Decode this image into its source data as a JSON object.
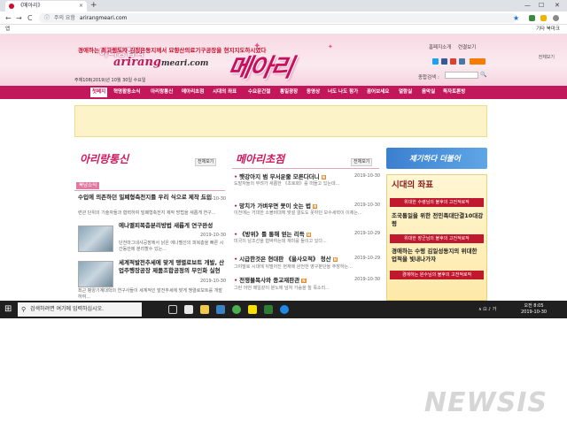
{
  "browser": {
    "tab_title": "《메아리》",
    "tab_close": "×",
    "new_tab": "+",
    "window_min": "—",
    "window_max": "☐",
    "window_close": "✕",
    "nav_back": "←",
    "nav_forward": "→",
    "nav_reload": "C",
    "security_label": "주의 요함",
    "url": "arirangmeari.com",
    "bookmark_apps": "앱",
    "bookmark_other": "기타 북마크"
  },
  "site": {
    "logo_korean": "아리랑협회",
    "logo_english": "arirang",
    "logo_domain": "meari.com",
    "date": "주체108(2019)년 10월 30일 수요일",
    "masthead": "메아리",
    "top_links": [
      "홈페지소개",
      "련결보기"
    ],
    "search_label": "종합검색 :",
    "search_button": "🔍"
  },
  "nav": [
    "첫페지",
    "혁명활동소식",
    "아리랑통신",
    "메아리초점",
    "시대의 좌표",
    "수요문건철",
    "통일광장",
    "동영상",
    "너도 나도 참가",
    "꼼어보세요",
    "열람실",
    "음악실",
    "독자토론방"
  ],
  "banner": {
    "text": "경애하는 최고령도자 김정은동지께서 묘향산의료기구공장을 현지지도하시였다",
    "more": "전체보기"
  },
  "left_section": {
    "title": "아리랑통신",
    "more": "전체보기",
    "subtab": "북남소식",
    "items": [
      {
        "title": "수입에 의존하던 밀폐형축전지를 우리 식으로 제작 도입",
        "summary": "련관 단위의 기술자들과 협력하여 밀폐형축전지 제작 방법을 새롭게 연구...",
        "date": "2019-10-30"
      },
      {
        "title": "에나멜피복층분리방법 새롭게 연구완성",
        "summary": "단천마그네샤공장에서 낡은 에나멜선의 피복층을 빠른 시간동안에 분리할수 있는...",
        "date": "2019-10-30"
      },
      {
        "title": "세계적발전추세에 맞게 맹렬로보트 개발, 산업주행장공장 제품조합공정의 무인화 실현",
        "summary": "최근 평양기계대학의 연구사들이 세계적인 발전추세에 맞게 맹렬로보트를 개발하여...",
        "date": "2019-10-30"
      }
    ]
  },
  "mid_section": {
    "title": "메아리초점",
    "more": "전체보기",
    "items": [
      {
        "title": "햇강아지 범 무서운줄 모른다더니",
        "summary": "도발자들의 무려가 새롭한 《초토화》를 떠들고 있는데...",
        "date": "2019-10-30"
      },
      {
        "title": "망치가 가벼우면 못이 솟는 법",
        "summary": "이전에는 거대한 소볼비대에 맞설 결도도 못하던 보수세력이 이제는...",
        "date": "2019-10-30"
      },
      {
        "title": "《방위》를 통해 얻는 리득",
        "summary": "미국이 남조선을 협박하는데 재미를 들이고 있다...",
        "date": "2019-10-29"
      },
      {
        "title": "시급한것은 현대판 《을사오적》 청산",
        "summary": "그야말로 시대에 뒤떨어진 현재에 완전한 영구분단을 주장하는...",
        "date": "2019-10-29"
      },
      {
        "title": "전쟁불목사와 종교재판관",
        "summary": "그런 어떤 매일같이 분노에 넘쳐 가슴을 칠 목소리...",
        "date": "2019-10-30"
      }
    ]
  },
  "right_section": {
    "banner": "제기하다 더불어",
    "box_title": "시대의 좌표",
    "bars": [
      "위대한 수령님의 불후의 고전적로작",
      "위대한 장군님의 불후의 고전적로작",
      "경애하는 원수님의 불후의 고전적로작"
    ],
    "texts": [
      "조국통일을 위한 전민족대단결10대강령",
      "경애하는 수령 김일성동지의 위대한 업적을 빛내나가자"
    ]
  },
  "taskbar": {
    "start_icon": "⊞",
    "search_icon": "⚲",
    "search_placeholder": "검색하려면 여기에 입력하십시오.",
    "tray": "∧ ⊡ ♪ 가",
    "time": "오전 8:05",
    "date": "2019-10-30"
  },
  "watermark": "NEWSIS"
}
